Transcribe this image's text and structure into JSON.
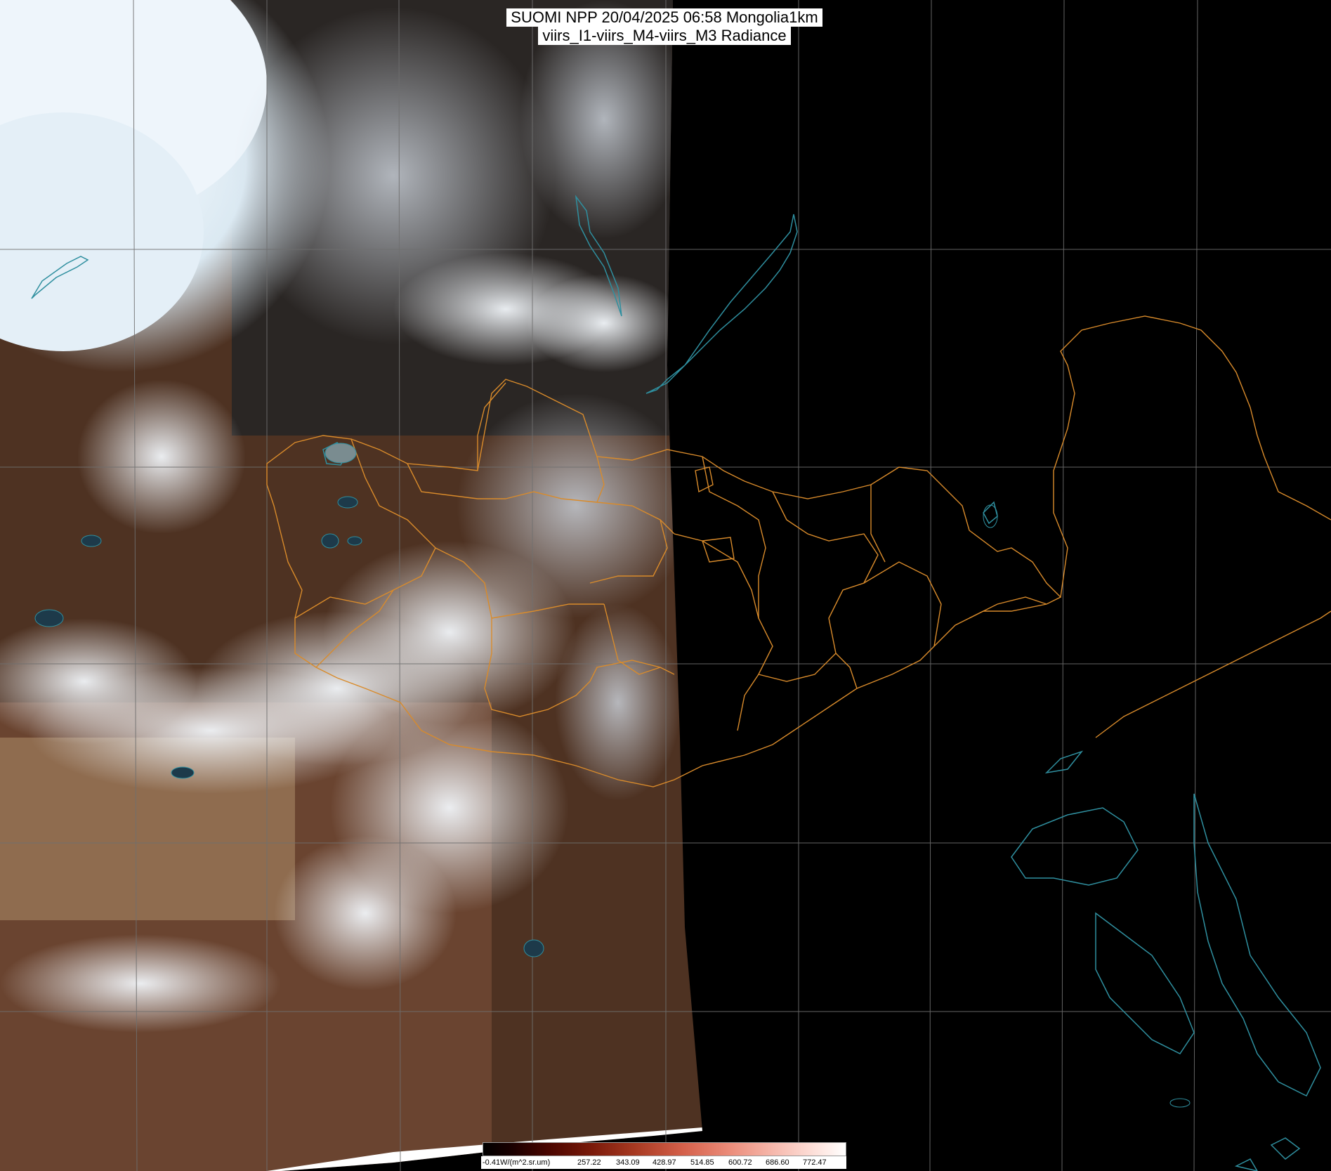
{
  "title": {
    "line1": "SUOMI NPP 20/04/2025 06:58 Mongolia1km",
    "line2": "viirs_I1-viirs_M4-viirs_M3 Radiance"
  },
  "colorbar": {
    "unit_label": "-0.41W/(m^2.sr.um)",
    "ticks": [
      "257.22",
      "343.09",
      "428.97",
      "514.85",
      "600.72",
      "686.60",
      "772.47"
    ]
  },
  "colors": {
    "border": "#d98b2b",
    "coast": "#2f8f9f",
    "grid": "#6f6f6f",
    "cloud": "#f2f6fa",
    "land": "#5b3a26",
    "desert": "#9c7c5c"
  }
}
